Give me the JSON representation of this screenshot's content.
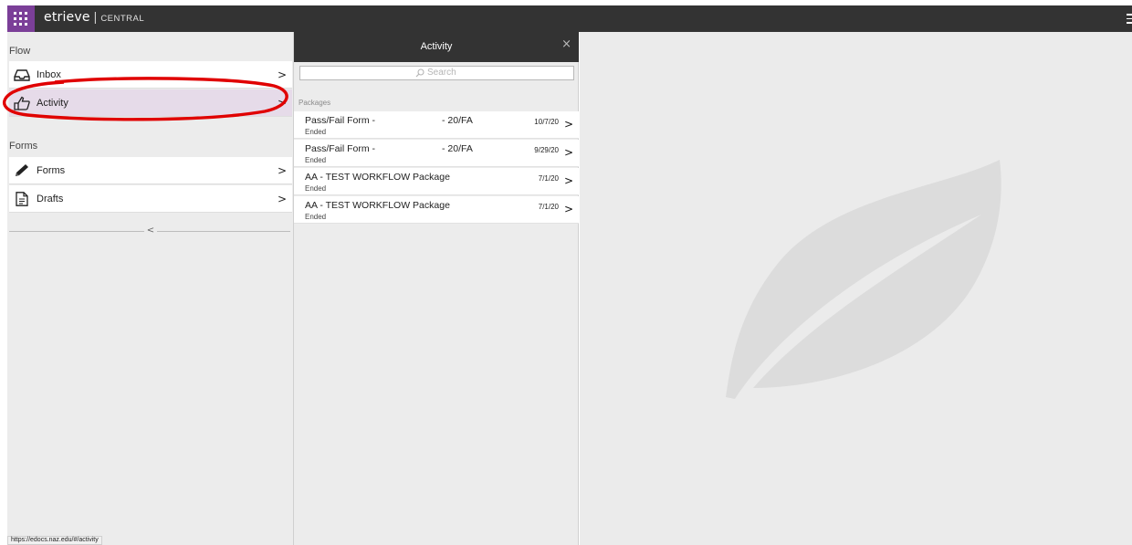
{
  "topbar": {
    "brand": "etrieve",
    "separator": "|",
    "product": "CENTRAL"
  },
  "leftnav": {
    "flow_label": "Flow",
    "flow_items": [
      {
        "label": "Inbox",
        "icon": "inbox-icon",
        "chevron": ">"
      },
      {
        "label": "Activity",
        "icon": "pointing-hand-icon",
        "chevron": ">"
      }
    ],
    "forms_label": "Forms",
    "forms_items": [
      {
        "label": "Forms",
        "icon": "pencil-icon",
        "chevron": ">"
      },
      {
        "label": "Drafts",
        "icon": "document-icon",
        "chevron": ">"
      }
    ],
    "collapse_arrow": "<"
  },
  "activity_panel": {
    "title": "Activity",
    "close": "×",
    "search_placeholder": "Search",
    "packages_label": "Packages",
    "packages": [
      {
        "title": "Pass/Fail Form -",
        "suffix": "- 20/FA",
        "status": "Ended",
        "date": "10/7/20"
      },
      {
        "title": "Pass/Fail Form -",
        "suffix": "- 20/FA",
        "status": "Ended",
        "date": "9/29/20"
      },
      {
        "title": "AA - TEST WORKFLOW Package",
        "suffix": "",
        "status": "Ended",
        "date": "7/1/20"
      },
      {
        "title": "AA - TEST WORKFLOW Package",
        "suffix": "",
        "status": "Ended",
        "date": "7/1/20"
      }
    ]
  },
  "status_bar": {
    "url": "https://edocs.naz.edu/#/activity"
  },
  "colors": {
    "topbar": "#333333",
    "apps_button": "#7b3f98",
    "active_item": "#e6dbe9",
    "annotation": "#e00000"
  }
}
